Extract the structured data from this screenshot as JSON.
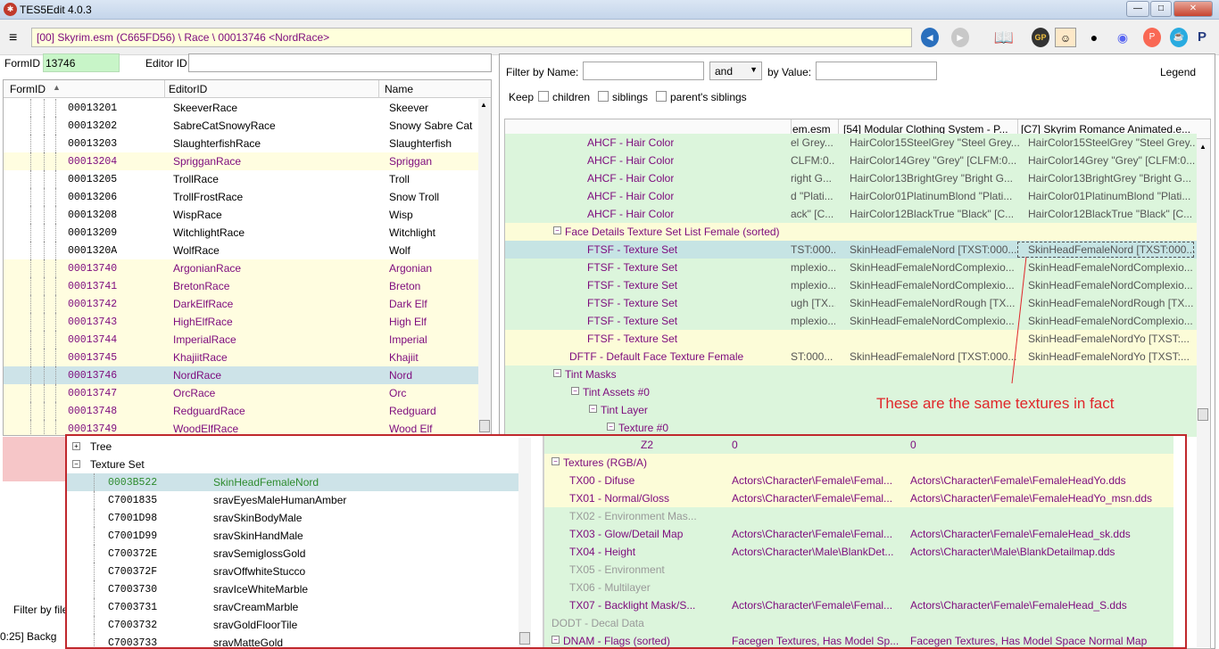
{
  "window": {
    "title": "TES5Edit 4.0.3",
    "min": "—",
    "max": "□",
    "close": "✕"
  },
  "toolbar": {
    "path": "[00] Skyrim.esm (C665FD56) \\ Race \\ 00013746 <NordRace>"
  },
  "form": {
    "formid_label": "FormID",
    "formid_value": "13746",
    "editorid_label": "Editor ID",
    "editorid_value": ""
  },
  "left_grid": {
    "headers": [
      "FormID",
      "EditorID",
      "Name"
    ],
    "rows": [
      {
        "id": "00013201",
        "editor": "SkeeverRace",
        "name": "Skeever",
        "style": "normal"
      },
      {
        "id": "00013202",
        "editor": "SabreCatSnowyRace",
        "name": "Snowy Sabre Cat",
        "style": "normal"
      },
      {
        "id": "00013203",
        "editor": "SlaughterfishRace",
        "name": "Slaughterfish",
        "style": "normal"
      },
      {
        "id": "00013204",
        "editor": "SprigganRace",
        "name": "Spriggan",
        "style": "yellow"
      },
      {
        "id": "00013205",
        "editor": "TrollRace",
        "name": "Troll",
        "style": "normal"
      },
      {
        "id": "00013206",
        "editor": "TrollFrostRace",
        "name": "Snow Troll",
        "style": "normal"
      },
      {
        "id": "00013208",
        "editor": "WispRace",
        "name": "Wisp",
        "style": "normal"
      },
      {
        "id": "00013209",
        "editor": "WitchlightRace",
        "name": "Witchlight",
        "style": "normal"
      },
      {
        "id": "0001320A",
        "editor": "WolfRace",
        "name": "Wolf",
        "style": "normal"
      },
      {
        "id": "00013740",
        "editor": "ArgonianRace",
        "name": "Argonian",
        "style": "yellow"
      },
      {
        "id": "00013741",
        "editor": "BretonRace",
        "name": "Breton",
        "style": "yellow"
      },
      {
        "id": "00013742",
        "editor": "DarkElfRace",
        "name": "Dark Elf",
        "style": "yellow"
      },
      {
        "id": "00013743",
        "editor": "HighElfRace",
        "name": "High Elf",
        "style": "yellow"
      },
      {
        "id": "00013744",
        "editor": "ImperialRace",
        "name": "Imperial",
        "style": "yellow"
      },
      {
        "id": "00013745",
        "editor": "KhajiitRace",
        "name": "Khajiit",
        "style": "yellow"
      },
      {
        "id": "00013746",
        "editor": "NordRace",
        "name": "Nord",
        "style": "selected"
      },
      {
        "id": "00013747",
        "editor": "OrcRace",
        "name": "Orc",
        "style": "yellow"
      },
      {
        "id": "00013748",
        "editor": "RedguardRace",
        "name": "Redguard",
        "style": "yellow"
      },
      {
        "id": "00013749",
        "editor": "WoodElfRace",
        "name": "Wood Elf",
        "style": "yellow"
      }
    ]
  },
  "bottom_left": {
    "filter_label": "Filter by file",
    "status": "0:25] Backg"
  },
  "right": {
    "filter_name_label": "Filter by Name:",
    "and_option": "and",
    "by_value_label": "by Value:",
    "legend": "Legend",
    "keep_label": "Keep",
    "keep_options": [
      "children",
      "siblings",
      "parent's siblings"
    ],
    "headers": [
      "em.esm",
      "[54] Modular Clothing System - P...",
      "[C7] Skyrim Romance Animated.e..."
    ],
    "rows": [
      {
        "indent": 4,
        "label": "AHCF - Hair Color",
        "v1": "el Grey...",
        "v2": "HairColor15SteelGrey \"Steel Grey...",
        "v3": "HairColor15SteelGrey \"Steel Grey...",
        "bg": "green",
        "exp": ""
      },
      {
        "indent": 4,
        "label": "AHCF - Hair Color",
        "v1": "CLFM:0...",
        "v2": "HairColor14Grey \"Grey\" [CLFM:0...",
        "v3": "HairColor14Grey \"Grey\" [CLFM:0...",
        "bg": "green",
        "exp": ""
      },
      {
        "indent": 4,
        "label": "AHCF - Hair Color",
        "v1": "right G...",
        "v2": "HairColor13BrightGrey \"Bright G...",
        "v3": "HairColor13BrightGrey \"Bright G...",
        "bg": "green",
        "exp": ""
      },
      {
        "indent": 4,
        "label": "AHCF - Hair Color",
        "v1": "d \"Plati...",
        "v2": "HairColor01PlatinumBlond \"Plati...",
        "v3": "HairColor01PlatinumBlond \"Plati...",
        "bg": "green",
        "exp": ""
      },
      {
        "indent": 4,
        "label": "AHCF - Hair Color",
        "v1": "ack\" [C...",
        "v2": "HairColor12BlackTrue \"Black\" [C...",
        "v3": "HairColor12BlackTrue \"Black\" [C...",
        "bg": "green",
        "exp": ""
      },
      {
        "indent": 3,
        "label": "Face Details Texture Set List Female (sorted)",
        "v1": "",
        "v2": "",
        "v3": "",
        "bg": "lyellow",
        "exp": "−"
      },
      {
        "indent": 4,
        "label": "FTSF - Texture Set",
        "v1": "TST:000...",
        "v2": "SkinHeadFemaleNord [TXST:000...",
        "v3": "SkinHeadFemaleNord [TXST:000...",
        "bg": "teal",
        "exp": ""
      },
      {
        "indent": 4,
        "label": "FTSF - Texture Set",
        "v1": "mplexio...",
        "v2": "SkinHeadFemaleNordComplexio...",
        "v3": "SkinHeadFemaleNordComplexio...",
        "bg": "green",
        "exp": ""
      },
      {
        "indent": 4,
        "label": "FTSF - Texture Set",
        "v1": "mplexio...",
        "v2": "SkinHeadFemaleNordComplexio...",
        "v3": "SkinHeadFemaleNordComplexio...",
        "bg": "green",
        "exp": ""
      },
      {
        "indent": 4,
        "label": "FTSF - Texture Set",
        "v1": "ugh [TX...",
        "v2": "SkinHeadFemaleNordRough [TX...",
        "v3": "SkinHeadFemaleNordRough [TX...",
        "bg": "green",
        "exp": ""
      },
      {
        "indent": 4,
        "label": "FTSF - Texture Set",
        "v1": "mplexio...",
        "v2": "SkinHeadFemaleNordComplexio...",
        "v3": "SkinHeadFemaleNordComplexio...",
        "bg": "green",
        "exp": ""
      },
      {
        "indent": 4,
        "label": "FTSF - Texture Set",
        "v1": "",
        "v2": "",
        "v3": "SkinHeadFemaleNordYo [TXST:...",
        "bg": "lyellow",
        "exp": ""
      },
      {
        "indent": 3,
        "label": "DFTF - Default Face Texture Female",
        "v1": "ST:000...",
        "v2": "SkinHeadFemaleNord [TXST:000...",
        "v3": "SkinHeadFemaleNordYo [TXST:...",
        "bg": "lyellow",
        "exp": ""
      },
      {
        "indent": 3,
        "label": "Tint Masks",
        "v1": "",
        "v2": "",
        "v3": "",
        "bg": "green",
        "exp": "−"
      },
      {
        "indent": 4,
        "label": "Tint Assets #0",
        "v1": "",
        "v2": "",
        "v3": "",
        "bg": "green",
        "exp": "−"
      },
      {
        "indent": 5,
        "label": "Tint Layer",
        "v1": "",
        "v2": "",
        "v3": "",
        "bg": "green",
        "exp": "−"
      },
      {
        "indent": 6,
        "label": "Texture #0",
        "v1": "",
        "v2": "",
        "v3": "",
        "bg": "green",
        "exp": "−"
      }
    ]
  },
  "overlay": {
    "tree_items": [
      {
        "label": "Tree",
        "exp": "+"
      },
      {
        "label": "Texture Set",
        "exp": "−"
      }
    ],
    "rows": [
      {
        "id": "0003B522",
        "name": "SkinHeadFemaleNord",
        "selected": true
      },
      {
        "id": "C7001835",
        "name": "sravEyesMaleHumanAmber",
        "selected": false
      },
      {
        "id": "C7001D98",
        "name": "sravSkinBodyMale",
        "selected": false
      },
      {
        "id": "C7001D99",
        "name": "sravSkinHandMale",
        "selected": false
      },
      {
        "id": "C700372E",
        "name": "sravSemiglossGold",
        "selected": false
      },
      {
        "id": "C700372F",
        "name": "sravOffwhiteStucco",
        "selected": false
      },
      {
        "id": "C7003730",
        "name": "sravIceWhiteMarble",
        "selected": false
      },
      {
        "id": "C7003731",
        "name": "sravCreamMarble",
        "selected": false
      },
      {
        "id": "C7003732",
        "name": "sravGoldFloorTile",
        "selected": false
      },
      {
        "id": "C7003733",
        "name": "sravMatteGold",
        "selected": false
      }
    ],
    "detail_rows": [
      {
        "label": "Z2",
        "b1": "0",
        "b2": "0",
        "bg": "green",
        "indent": 5,
        "gray": false
      },
      {
        "label": "Textures (RGB/A)",
        "b1": "",
        "b2": "",
        "bg": "lyellow",
        "indent": 0,
        "gray": false,
        "exp": "−"
      },
      {
        "label": "TX00 - Difuse",
        "b1": "Actors\\Character\\Female\\Femal...",
        "b2": "Actors\\Character\\Female\\FemaleHeadYo.dds",
        "bg": "lyellow",
        "indent": 1,
        "gray": false
      },
      {
        "label": "TX01 - Normal/Gloss",
        "b1": "Actors\\Character\\Female\\Femal...",
        "b2": "Actors\\Character\\Female\\FemaleHeadYo_msn.dds",
        "bg": "lyellow",
        "indent": 1,
        "gray": false
      },
      {
        "label": "TX02 - Environment Mas...",
        "b1": "",
        "b2": "",
        "bg": "green",
        "indent": 1,
        "gray": true
      },
      {
        "label": "TX03 - Glow/Detail Map",
        "b1": "Actors\\Character\\Female\\Femal...",
        "b2": "Actors\\Character\\Female\\FemaleHead_sk.dds",
        "bg": "green",
        "indent": 1,
        "gray": false
      },
      {
        "label": "TX04 - Height",
        "b1": "Actors\\Character\\Male\\BlankDet...",
        "b2": "Actors\\Character\\Male\\BlankDetailmap.dds",
        "bg": "green",
        "indent": 1,
        "gray": false
      },
      {
        "label": "TX05 - Environment",
        "b1": "",
        "b2": "",
        "bg": "green",
        "indent": 1,
        "gray": true
      },
      {
        "label": "TX06 - Multilayer",
        "b1": "",
        "b2": "",
        "bg": "green",
        "indent": 1,
        "gray": true
      },
      {
        "label": "TX07 - Backlight Mask/S...",
        "b1": "Actors\\Character\\Female\\Femal...",
        "b2": "Actors\\Character\\Female\\FemaleHead_S.dds",
        "bg": "green",
        "indent": 1,
        "gray": false
      },
      {
        "label": "DODT - Decal Data",
        "b1": "",
        "b2": "",
        "bg": "green",
        "indent": 0,
        "gray": true
      },
      {
        "label": "DNAM - Flags (sorted)",
        "b1": "Facegen Textures, Has Model Sp...",
        "b2": "Facegen Textures, Has Model Space Normal Map",
        "bg": "green",
        "indent": 0,
        "gray": false,
        "exp": "−"
      }
    ]
  },
  "annotation": "These are the same textures in fact",
  "colors": {
    "purple_text": "#7d0a7d",
    "green_row": "#dcf5dc",
    "yellow_row": "#fffde0",
    "annotation_red": "#e0262a"
  }
}
